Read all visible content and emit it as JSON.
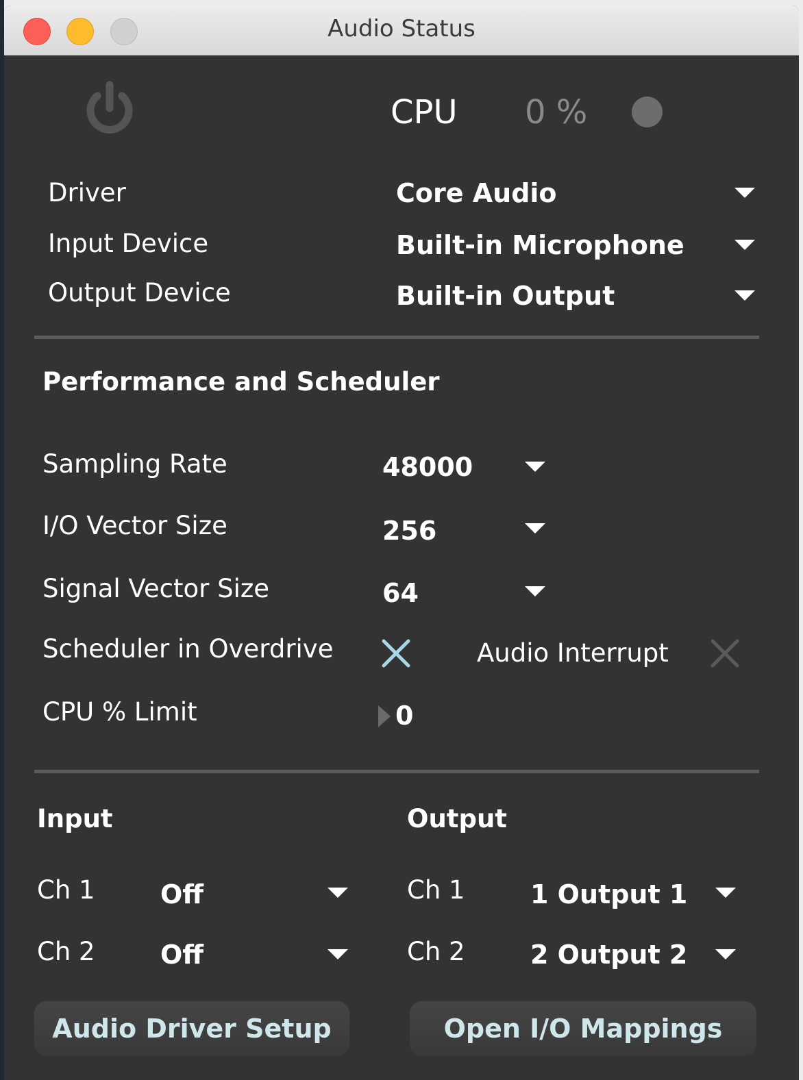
{
  "window": {
    "title": "Audio Status"
  },
  "status": {
    "cpu_label": "CPU",
    "cpu_value": "0 %"
  },
  "devices": {
    "driver_label": "Driver",
    "driver_value": "Core Audio",
    "input_label": "Input Device",
    "input_value": "Built-in Microphone",
    "output_label": "Output Device",
    "output_value": "Built-in Output"
  },
  "performance": {
    "heading": "Performance and Scheduler",
    "sampling_rate_label": "Sampling Rate",
    "sampling_rate_value": "48000",
    "io_vector_label": "I/O Vector Size",
    "io_vector_value": "256",
    "signal_vector_label": "Signal Vector Size",
    "signal_vector_value": "64",
    "overdrive_label": "Scheduler in Overdrive",
    "overdrive_enabled": true,
    "interrupt_label": "Audio Interrupt",
    "interrupt_enabled": false,
    "cpu_limit_label": "CPU % Limit",
    "cpu_limit_value": "0"
  },
  "io": {
    "input_heading": "Input",
    "output_heading": "Output",
    "input_channels": [
      {
        "label": "Ch 1",
        "value": "Off"
      },
      {
        "label": "Ch 2",
        "value": "Off"
      }
    ],
    "output_channels": [
      {
        "label": "Ch 1",
        "value": "1 Output 1"
      },
      {
        "label": "Ch 2",
        "value": "2 Output 2"
      }
    ]
  },
  "buttons": {
    "driver_setup": "Audio Driver Setup",
    "io_mappings": "Open I/O Mappings"
  },
  "colors": {
    "panel_bg": "#333333",
    "button_text": "#cfe6ea",
    "toggle_on": "#a8d8e8",
    "toggle_off": "#5a5a5a"
  }
}
